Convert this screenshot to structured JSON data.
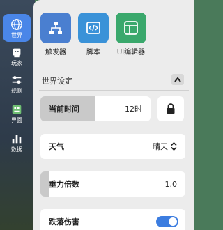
{
  "sidebar": {
    "items": [
      {
        "label": "世界",
        "icon": "globe-icon",
        "active": true
      },
      {
        "label": "玩家",
        "icon": "player-icon",
        "active": false
      },
      {
        "label": "规则",
        "icon": "rules-icon",
        "active": false
      },
      {
        "label": "界面",
        "icon": "interface-icon",
        "active": false
      },
      {
        "label": "数据",
        "icon": "data-icon",
        "active": false
      }
    ]
  },
  "tools": [
    {
      "label": "触发器",
      "icon": "trigger-icon",
      "color": "#4a7fd0"
    },
    {
      "label": "脚本",
      "icon": "script-icon",
      "color": "#3a92d8"
    },
    {
      "label": "UI编辑器",
      "icon": "ui-editor-icon",
      "color": "#3aa86c"
    }
  ],
  "section": {
    "title": "世界设定"
  },
  "settings": {
    "time": {
      "name": "当前时间",
      "value": "12时",
      "level": 0.5
    },
    "weather": {
      "name": "天气",
      "value": "晴天"
    },
    "gravity": {
      "name": "重力倍数",
      "value": "1.0",
      "level": 0.06
    },
    "fall_damage": {
      "name": "跌落伤害",
      "on": true
    }
  }
}
